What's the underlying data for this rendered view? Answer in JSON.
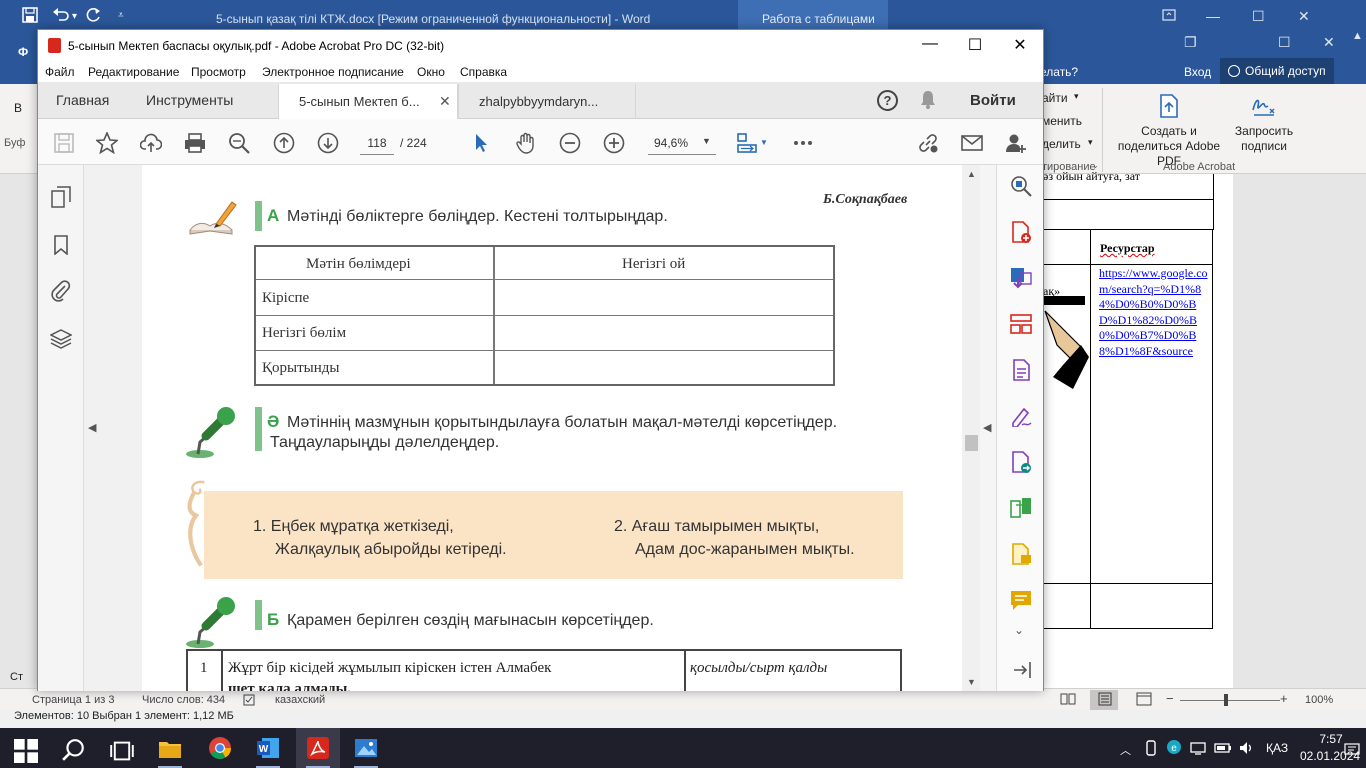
{
  "word": {
    "title": "5-сынып қазақ тілі КТЖ.docx [Режим ограниченной функциональности] - Word",
    "context_tab": "Работа с таблицами",
    "help": "елать?",
    "login": "Вход",
    "share": "Общий доступ",
    "ribbon": {
      "small_items": [
        "айти",
        "менить",
        "делить"
      ],
      "group_edit": "тирование",
      "create_pdf": "Создать и поделиться Adobe PDF",
      "request_sign": "Запросить подписи",
      "group_adobe": "Adobe Acrobat",
      "left_letters": [
        "В",
        "Буф",
        "Ф"
      ]
    },
    "doc": {
      "fragment1": "әз ойын айтуға, зат",
      "fragment2": "ақ»",
      "resources_header": "Ресурстар",
      "resource_link": "https://www.google.com/search?q=%D1%84%D0%B0%D0%BD%D1%82%D0%B0%D0%B7%D0%B8%D1%8F&source",
      "left_fragment": "Ст"
    },
    "status": {
      "page": "Страница 1 из 3",
      "words": "Число слов: 434",
      "lang": "казахский",
      "zoom": "100%"
    },
    "explorer": "Элементов: 10     Выбран 1 элемент: 1,12 МБ"
  },
  "taskbar": {
    "time": "7:57",
    "date": "02.01.2024",
    "lang": "ҚАЗ"
  },
  "acrobat": {
    "title": "5-сынып Мектеп баспасы оқулық.pdf - Adobe Acrobat Pro DC (32-bit)",
    "menu": [
      "Файл",
      "Редактирование",
      "Просмотр",
      "Электронное подписание",
      "Окно",
      "Справка"
    ],
    "tabs": {
      "home": "Главная",
      "tools": "Инструменты",
      "doc1": "5-сынып Мектеп б...",
      "doc2": "zhalpybbyymdaryn..."
    },
    "signin": "Войти",
    "page_current": "118",
    "page_total": "/ 224",
    "zoom": "94,6%",
    "page": {
      "author": "Б.Соқпақбаев",
      "task_a_letter": "А",
      "task_a_text": "Мәтінді бөліктерге бөліңдер. Кестені толтырыңдар.",
      "table_headers": [
        "Мәтін  бөлімдері",
        "Негізгі  ой"
      ],
      "table_rows": [
        "Кіріспе",
        "Негізгі  бөлім",
        "Қорытынды"
      ],
      "task_ae_letter": "Ә",
      "task_ae_text1": "Мәтіннің мазмұнын қорытындылауға болатын мақал-мәтелді көрсетіңдер.",
      "task_ae_text2": "Таңдауларыңды дәлелдеңдер.",
      "proverb1_line1": "1. Еңбек мұратқа жеткізеді,",
      "proverb1_line2": "Жалқаулық абыройды кетіреді.",
      "proverb2_line1": "2. Ағаш тамырымен мықты,",
      "proverb2_line2": "Адам дос-жаранымен мықты.",
      "task_b_letter": "Б",
      "task_b_text": "Қарамен берілген сөздің мағынасын көрсетіңдер.",
      "btable_num": "1",
      "btable_text": "Жұрт  бір  кісідей  жұмылып   кіріскен   істен  Алмабек",
      "btable_text2": "шет  қала  алмады.",
      "btable_options": "қосылды/сырт     қалды"
    }
  },
  "colors": {
    "word_blue": "#2b579a",
    "acrobat_red": "#d7281e",
    "task_green": "#3aa24a",
    "proverb_bg": "#fbe3c6",
    "taskbar": "#1f1f2b"
  }
}
